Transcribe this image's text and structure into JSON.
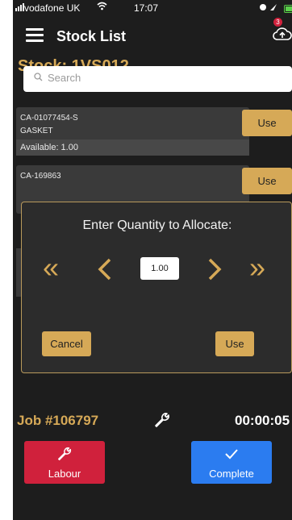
{
  "status_bar": {
    "carrier": "vodafone UK",
    "time": "17:07"
  },
  "header": {
    "title": "Stock List",
    "sync_badge_count": "3"
  },
  "stock_title": "Stock: 1VS012",
  "search": {
    "placeholder": "Search"
  },
  "items": [
    {
      "code": "CA-01077454-S",
      "description": "GASKET",
      "available": "Available: 1.00",
      "use_label": "Use"
    },
    {
      "code": "CA-169863",
      "use_label": "Use"
    }
  ],
  "dialog": {
    "title": "Enter Quantity to Allocate:",
    "quantity": "1.00",
    "cancel_label": "Cancel",
    "use_label": "Use"
  },
  "footer": {
    "job_number": "Job #106797",
    "timer": "00:00:05",
    "labour_label": "Labour",
    "complete_label": "Complete"
  },
  "colors": {
    "accent_gold": "#d6a957",
    "labour_red": "#d0213c",
    "complete_blue": "#2b7cf0",
    "background": "#1d1d1d"
  }
}
